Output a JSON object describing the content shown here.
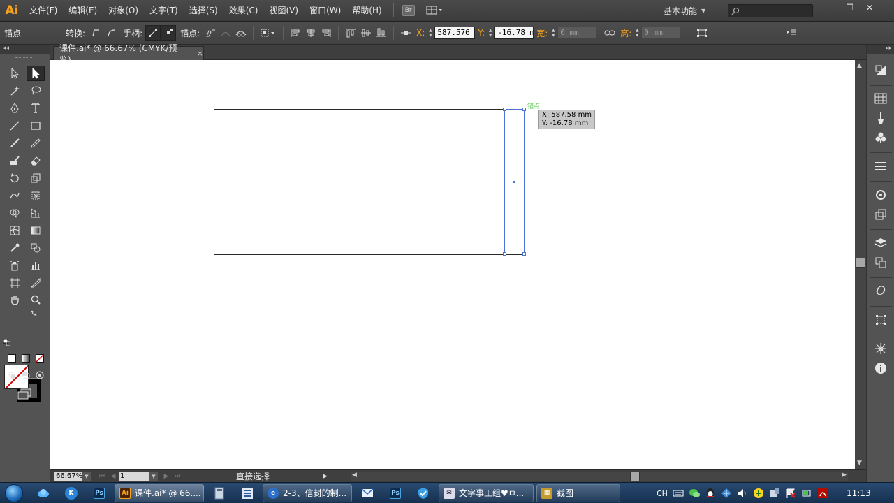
{
  "app": {
    "logo": "Ai"
  },
  "menu": [
    "文件(F)",
    "编辑(E)",
    "对象(O)",
    "文字(T)",
    "选择(S)",
    "效果(C)",
    "视图(V)",
    "窗口(W)",
    "帮助(H)"
  ],
  "bridge_label": "Br",
  "workspace": {
    "label": "基本功能"
  },
  "search": {
    "placeholder": ""
  },
  "window_controls": {
    "minimize": "–",
    "restore": "❐",
    "close": "✕"
  },
  "controlbar": {
    "anchor_label": "锚点",
    "convert_label": "转换:",
    "handles_label": "手柄:",
    "anchors_label": "锚点:",
    "x_label": "X:",
    "x_value": "587.576 m",
    "y_label": "Y:",
    "y_value": "-16.78 mm",
    "w_label": "宽:",
    "w_value": "0 mm",
    "h_label": "高:",
    "h_value": "0 mm"
  },
  "document": {
    "tab_title": "课件.ai* @ 66.67% (CMYK/预览)",
    "close_icon": "×"
  },
  "canvas": {
    "anchor_hint": "锚点",
    "tooltip_x": "X: 587.58 mm",
    "tooltip_y": "Y: -16.78 mm"
  },
  "statusbar": {
    "zoom": "66.67%",
    "page": "1",
    "current_tool": "直接选择"
  },
  "taskbar": {
    "tasks": [
      {
        "label": "课件.ai* @ 66....",
        "icon": "Ai",
        "color": "#6b3a12"
      },
      {
        "label": "2-3、信封的制...",
        "icon": "e",
        "color": "#2a6fc9"
      },
      {
        "label": "文字事工组♥ㅁ...",
        "icon": "✉",
        "color": "#445"
      },
      {
        "label": "截图",
        "icon": "▦",
        "color": "#c49a2c"
      }
    ],
    "ime": "CH",
    "clock": "11:13"
  },
  "colors": {
    "accent": "#f7a21b",
    "selection": "#4a72d6",
    "anchor_hint": "#6ecf62"
  }
}
